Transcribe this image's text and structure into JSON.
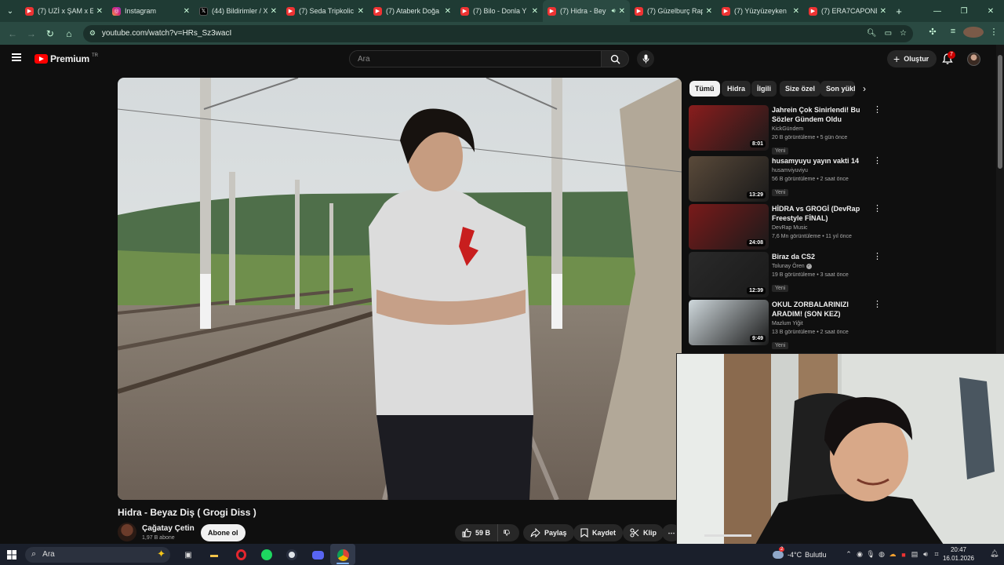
{
  "browser": {
    "tabs": [
      {
        "label": "(7) UZİ x ŞAM x E",
        "favicon": "youtube"
      },
      {
        "label": "Instagram",
        "favicon": "instagram"
      },
      {
        "label": "(44) Bildirimler / X",
        "favicon": "x"
      },
      {
        "label": "(7) Seda Tripkolic",
        "favicon": "youtube"
      },
      {
        "label": "(7) Ataberk Doğa",
        "favicon": "youtube"
      },
      {
        "label": "(7) Bilo - Donla Y",
        "favicon": "youtube"
      },
      {
        "label": "(7) Hidra - Bey",
        "favicon": "youtube",
        "active": true,
        "audio": true
      },
      {
        "label": "(7) Güzelburç Rap",
        "favicon": "youtube"
      },
      {
        "label": "(7) Yüzyüzeyken",
        "favicon": "youtube"
      },
      {
        "label": "(7) ERA7CAPONE",
        "favicon": "youtube"
      }
    ],
    "url": "youtube.com/watch?v=HRs_Sz3wacI"
  },
  "youtube": {
    "logo_text": "Premium",
    "country": "TR",
    "search_placeholder": "Ara",
    "create_label": "Oluştur",
    "notification_count": "7",
    "video": {
      "title": "Hidra - Beyaz Diş ( Grogi Diss )",
      "channel": "Çağatay Çetin",
      "subscribers": "1,97 B abone",
      "subscribe_label": "Abone ol",
      "likes": "59 B",
      "share_label": "Paylaş",
      "save_label": "Kaydet",
      "clip_label": "Klip"
    },
    "chips": [
      "Tümü",
      "Hidra",
      "İlgili",
      "Size özel",
      "Son yükl"
    ],
    "recommendations": [
      {
        "title": "Jahrein Çok Sinirlendi! Bu Sözler Gündem Oldu",
        "channel": "KickGündem",
        "meta": "20 B görüntüleme • 5 gün önce",
        "badge": "Yeni",
        "duration": "8:01",
        "thumb_color": "#8a1d1d"
      },
      {
        "title": "husamyuyu yayın vakti 14",
        "channel": "husamviyuviyu",
        "meta": "56 B görüntüleme • 2 saat önce",
        "badge": "Yeni",
        "duration": "13:29",
        "thumb_color": "#5a4a3a"
      },
      {
        "title": "HİDRA vs GROGİ (DevRap Freestyle FİNAL)",
        "channel": "DevRap Music",
        "meta": "7,6 Mn görüntüleme • 11 yıl önce",
        "badge": "",
        "duration": "24:08",
        "thumb_color": "#7a1a1a"
      },
      {
        "title": "Biraz da CS2",
        "channel": "Tolunay Ören",
        "meta": "19 B görüntüleme • 3 saat önce",
        "badge": "Yeni",
        "duration": "12:39",
        "thumb_color": "#2a2a2a",
        "verified": true
      },
      {
        "title": "OKUL ZORBALARINIZI ARADIM! (SON KEZ)",
        "channel": "Mazlum Yiğit",
        "meta": "13 B görüntüleme • 2 saat önce",
        "badge": "Yeni",
        "duration": "9:49",
        "thumb_color": "#cfd8dc"
      }
    ]
  },
  "taskbar": {
    "search_label": "Ara",
    "weather_temp": "-4°C",
    "weather_text": "Bulutlu",
    "weather_badge": "2",
    "time": "20:47",
    "date": "16.01.2026"
  }
}
